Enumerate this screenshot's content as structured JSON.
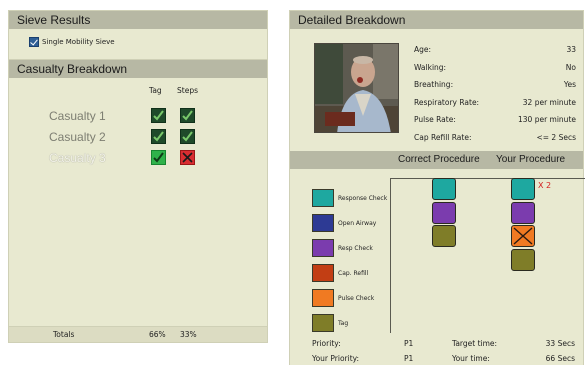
{
  "sieve": {
    "title": "Sieve Results",
    "checkbox_label": "Single Mobility Sieve"
  },
  "casualty": {
    "title": "Casualty Breakdown",
    "col_tag": "Tag",
    "col_steps": "Steps",
    "rows": [
      {
        "name": "Casualty 1",
        "tag": "check",
        "steps": "check",
        "style": "dark"
      },
      {
        "name": "Casualty 2",
        "tag": "check",
        "steps": "check",
        "style": "dark"
      },
      {
        "name": "Casualty 3",
        "tag": "check",
        "steps": "cross",
        "style": "highlight"
      }
    ],
    "totals_label": "Totals",
    "totals_tag": "66%",
    "totals_steps": "33%"
  },
  "detail": {
    "title": "Detailed Breakdown",
    "vitals": [
      {
        "label": "Age:",
        "value": "33"
      },
      {
        "label": "Walking:",
        "value": "No"
      },
      {
        "label": "Breathing:",
        "value": "Yes"
      },
      {
        "label": "Respiratory Rate:",
        "value": "32 per minute"
      },
      {
        "label": "Pulse Rate:",
        "value": "130 per minute"
      },
      {
        "label": "Cap Refill Rate:",
        "value": "<= 2 Secs"
      }
    ],
    "col_correct": "Correct Procedure",
    "col_yours": "Your Procedure",
    "legend": [
      {
        "label": "Response Check",
        "color": "#1ea8a0"
      },
      {
        "label": "Open Airway",
        "color": "#2d3a94"
      },
      {
        "label": "Resp Check",
        "color": "#7b3cae"
      },
      {
        "label": "Cap. Refill",
        "color": "#c23e14"
      },
      {
        "label": "Pulse Check",
        "color": "#f07a22"
      },
      {
        "label": "Tag",
        "color": "#7f7d28"
      }
    ],
    "repeat_marker": "X 2",
    "priority_label": "Priority:",
    "priority_value": "P1",
    "your_priority_label": "Your Priority:",
    "your_priority_value": "P1",
    "target_time_label": "Target time:",
    "target_time_value": "33 Secs",
    "your_time_label": "Your time:",
    "your_time_value": "66 Secs"
  }
}
